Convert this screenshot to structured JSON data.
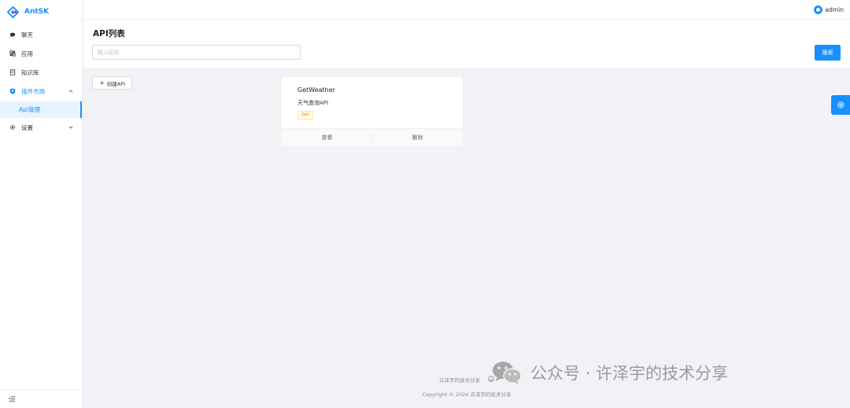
{
  "app": {
    "name": "AntSK"
  },
  "sidebar": {
    "items": [
      {
        "label": "聊天",
        "icon": "chat-icon"
      },
      {
        "label": "应用",
        "icon": "apps-icon"
      },
      {
        "label": "知识库",
        "icon": "book-icon"
      },
      {
        "label": "插件市场",
        "icon": "plugin-icon",
        "expanded": true,
        "children": [
          {
            "label": "Api管理",
            "selected": true
          }
        ]
      },
      {
        "label": "设置",
        "icon": "gear-icon"
      }
    ]
  },
  "header": {
    "user": "admin"
  },
  "page": {
    "title": "API列表",
    "search": {
      "placeholder": "输入回车",
      "value": "",
      "button": "搜索"
    },
    "create_button": "创建API"
  },
  "cards": [
    {
      "title": "GetWeather",
      "description": "天气查询API",
      "tag": "Get",
      "actions": [
        "查看",
        "删除"
      ]
    }
  ],
  "footer": {
    "link": "许泽宇的技术分享",
    "copyright": "Copyright © 2024 许泽宇的技术分享"
  },
  "watermark": {
    "text": "公众号 · 许泽宇的技术分享"
  },
  "colors": {
    "primary": "#1890ff",
    "background": "#f0f2f5",
    "tag_bg": "#fffbe6",
    "tag_text": "#d48806"
  }
}
